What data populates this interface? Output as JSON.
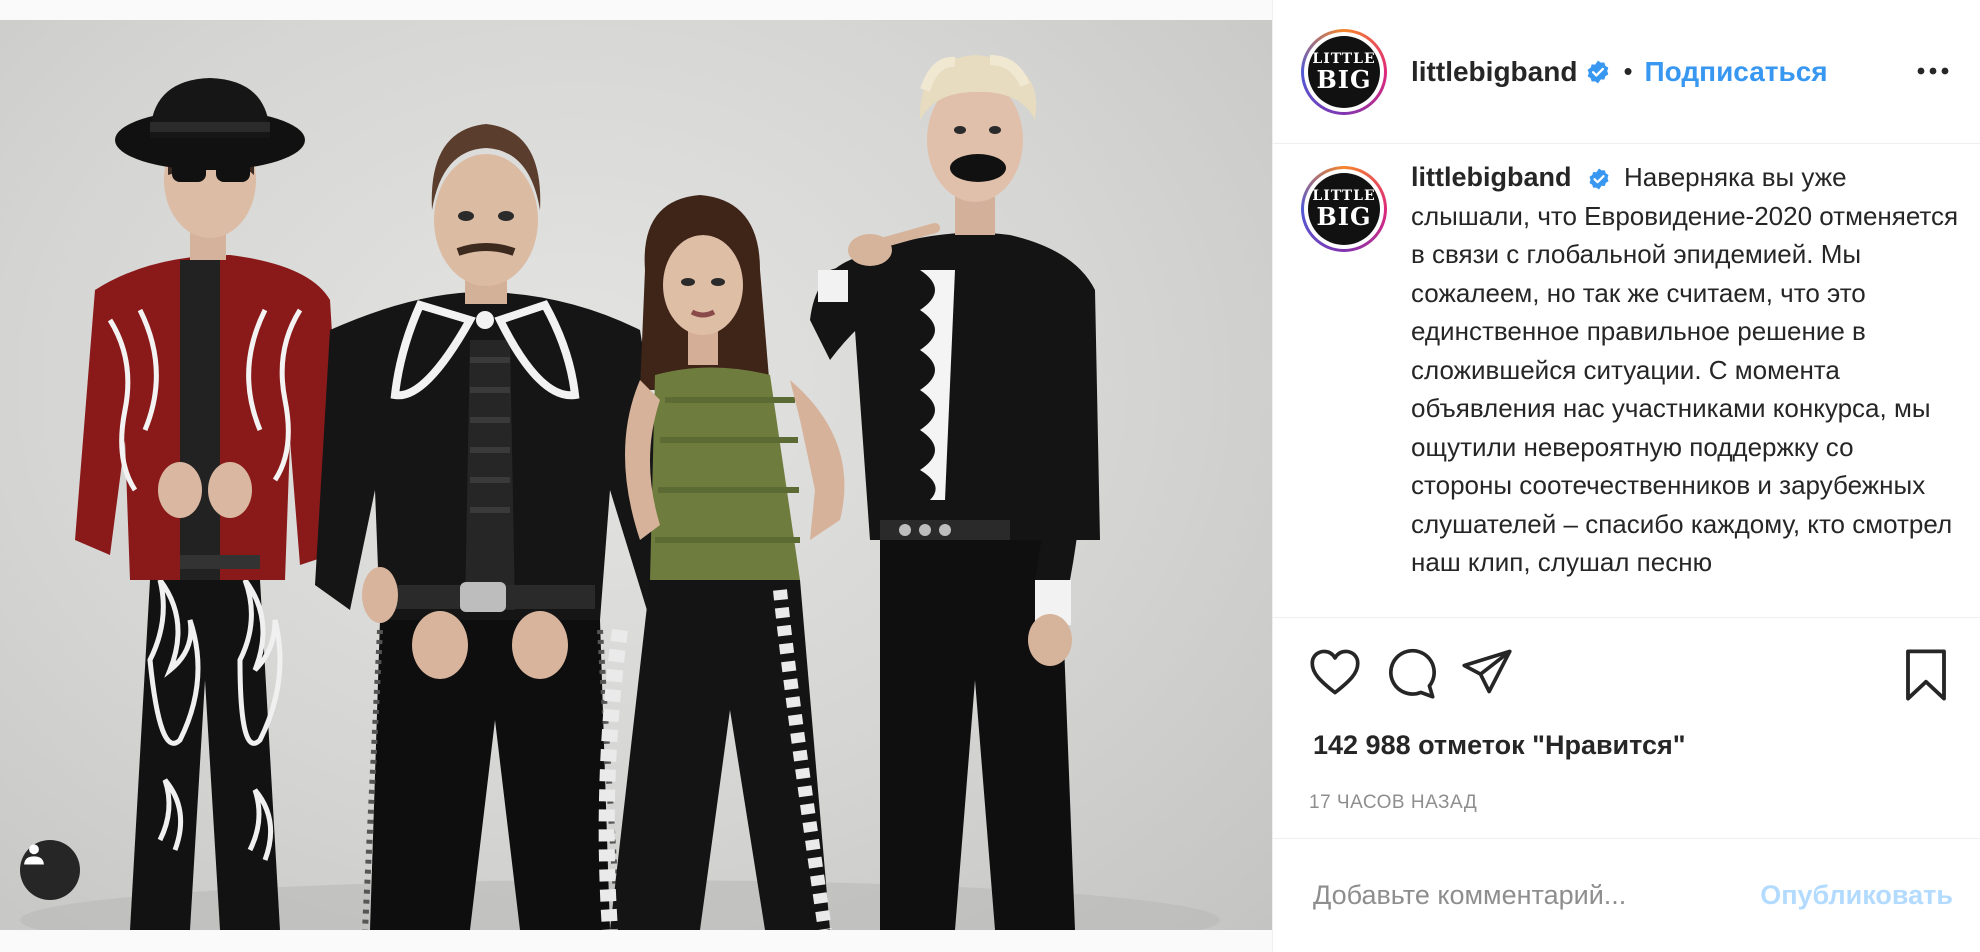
{
  "post": {
    "image_alt": "Фото группы Little Big",
    "tag_icon": "person-tag-icon"
  },
  "header": {
    "avatar_text_top": "LITTLE",
    "avatar_text_bottom": "BIG",
    "username": "littlebigband",
    "separator": "•",
    "follow_label": "Подписаться"
  },
  "caption": {
    "username": "littlebigband",
    "text": "Наверняка вы уже слышали, что Евровидение-2020 отменяется в связи с глобальной эпидемией. Мы сожалеем, но так же считаем, что это единственное правильное решение в сложившейся ситуации. С момента объявления нас участниками конкурса, мы ощутили невероятную поддержку со стороны соотечественников и зарубежных слушателей – спасибо каждому, кто смотрел наш клип, слушал песню"
  },
  "actions": {
    "icons": [
      "heart-icon",
      "comment-icon",
      "share-icon",
      "bookmark-icon"
    ]
  },
  "likes_text": "142 988 отметок \"Нравится\"",
  "timestamp": "17 ЧАСОВ НАЗАД",
  "comment": {
    "placeholder": "Добавьте комментарий...",
    "publish_label": "Опубликовать"
  },
  "colors": {
    "accent": "#3897f0",
    "publish_disabled": "#b3dbff",
    "muted": "#8e8e8e",
    "text": "#262626"
  }
}
